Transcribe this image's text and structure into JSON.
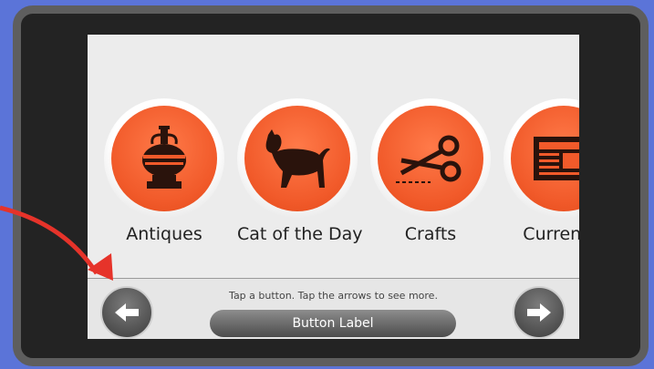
{
  "tiles": [
    {
      "label": "Antiques",
      "icon": "vase-icon"
    },
    {
      "label": "Cat of the Day",
      "icon": "cat-icon"
    },
    {
      "label": "Crafts",
      "icon": "scissors-icon"
    },
    {
      "label": "Current E",
      "icon": "newspaper-icon"
    }
  ],
  "footer": {
    "hint": "Tap a button. Tap the arrows to see more.",
    "button_label": "Button Label"
  },
  "nav": {
    "prev_icon": "arrow-left-icon",
    "next_icon": "arrow-right-icon"
  },
  "colors": {
    "tile_disc": "#f15a2a",
    "callout_arrow": "#e6332a",
    "background": "#5b74d8"
  }
}
